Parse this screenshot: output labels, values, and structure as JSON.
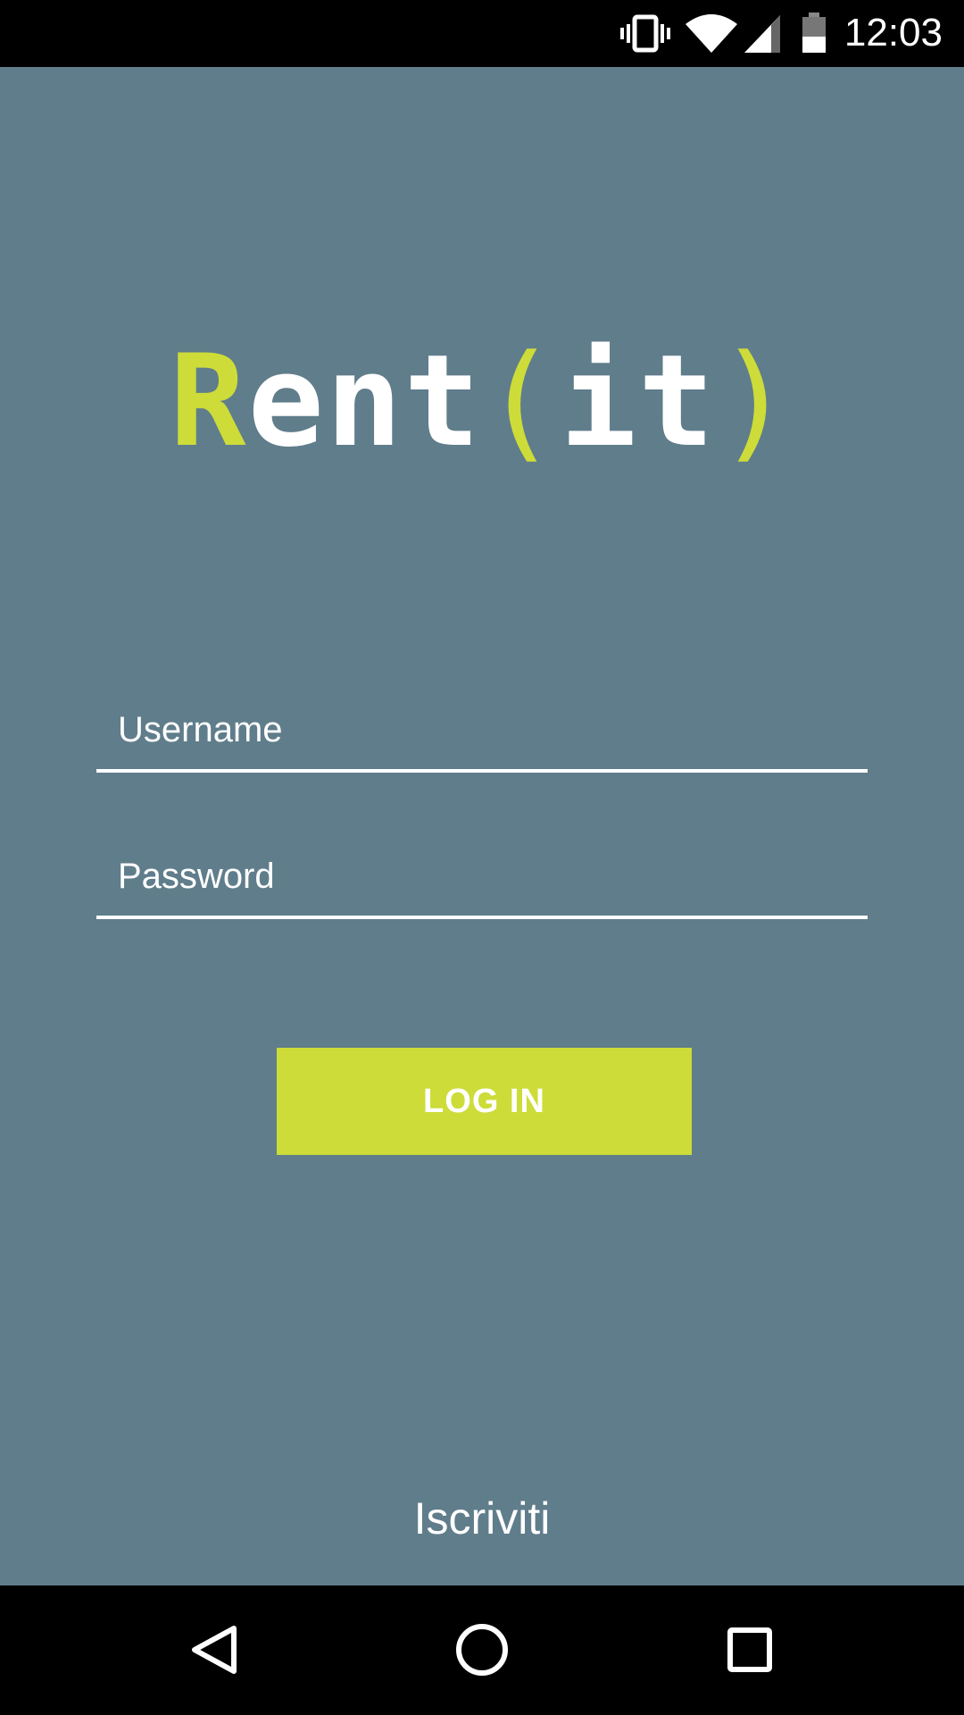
{
  "status_bar": {
    "time": "12:03",
    "icons": [
      "vibrate-icon",
      "wifi-icon",
      "cell-signal-icon",
      "battery-icon"
    ]
  },
  "logo": {
    "part_r": "R",
    "part_ent": "ent",
    "bracket_open": "(",
    "part_it": "it",
    "bracket_close": ")"
  },
  "form": {
    "username_placeholder": "Username",
    "username_value": "",
    "password_placeholder": "Password",
    "password_value": ""
  },
  "login_button": {
    "label": "LOG IN"
  },
  "signup_link": {
    "label": "Iscriviti"
  },
  "nav_bar": {
    "icons": [
      "back-icon",
      "home-icon",
      "recents-icon"
    ]
  },
  "colors": {
    "background": "#607D8B",
    "accent": "#CDDC39",
    "text": "#FFFFFF",
    "system_bars": "#000000"
  }
}
